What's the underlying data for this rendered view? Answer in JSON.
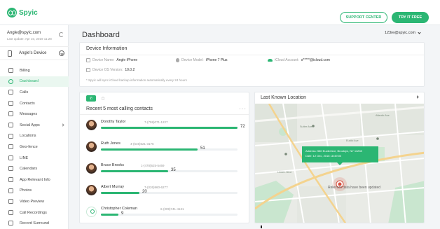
{
  "app": {
    "name": "Spyic"
  },
  "header": {
    "support_label": "SUPPORT CENTER",
    "try_label": "TRY IT FREE"
  },
  "account": {
    "email": "Angle@spyic.com",
    "last_update": "Last update: Apr 10, 2019 11:28"
  },
  "device": {
    "name": "Angle's Device"
  },
  "sidebar": {
    "items": [
      {
        "label": "Billing",
        "icon": "billing-icon",
        "active": false
      },
      {
        "label": "Dashboard",
        "icon": "dashboard-icon",
        "active": true
      },
      {
        "label": "Calls",
        "icon": "phone-icon",
        "active": false
      },
      {
        "label": "Contacts",
        "icon": "contacts-icon",
        "active": false
      },
      {
        "label": "Messages",
        "icon": "message-icon",
        "active": false
      },
      {
        "label": "Social Apps",
        "icon": "social-icon",
        "active": false,
        "has_submenu": true
      },
      {
        "label": "Locations",
        "icon": "location-icon",
        "active": false
      },
      {
        "label": "Geo-fence",
        "icon": "geofence-icon",
        "active": false
      },
      {
        "label": "LINE",
        "icon": "line-icon",
        "active": false
      },
      {
        "label": "Calendars",
        "icon": "calendar-icon",
        "active": false
      },
      {
        "label": "App Relevant Info",
        "icon": "app-info-icon",
        "active": false
      },
      {
        "label": "Photos",
        "icon": "photo-icon",
        "active": false
      },
      {
        "label": "Video Preview",
        "icon": "video-icon",
        "active": false
      },
      {
        "label": "Call Recordings",
        "icon": "mic-icon",
        "active": false
      },
      {
        "label": "Record Surround",
        "icon": "record-icon",
        "active": false
      }
    ]
  },
  "main": {
    "title": "Dashboard",
    "user": "123re@spyic.com"
  },
  "device_info": {
    "title": "Device Information",
    "name_label": "Device Name:",
    "name_value": "Angle iPhone",
    "model_label": "Device Model:",
    "model_value": "iPhone 7 Plus",
    "icloud_label": "iCloud Account:",
    "icloud_value": "s*****@icloud.com",
    "os_label": "Device OS Version:",
    "os_value": "10.0.2",
    "note": "* Spyic will sync iCloud backup information automatically every 24 hours"
  },
  "calls": {
    "title": "Recent 5 most calling contacts",
    "contacts": [
      {
        "name": "Dorothy Taylor",
        "phone": "7-(759)071-1227",
        "count": 72,
        "fill": 1.0
      },
      {
        "name": "Ruth Jones",
        "phone": "4-(646)521-3176",
        "count": 51,
        "fill": 0.71
      },
      {
        "name": "Bruce Brooks",
        "phone": "1-(478)625-5469",
        "count": 35,
        "fill": 0.49
      },
      {
        "name": "Albert Murray",
        "phone": "7-(026)960-6277",
        "count": 20,
        "fill": 0.28
      },
      {
        "name": "Christopher Coleman",
        "phone": "6-(009)741-4131",
        "count": 9,
        "fill": 0.13
      }
    ]
  },
  "location": {
    "title": "Last Known Location",
    "address": "Address: 580 Euclid Ave, Brooklyn, NY 11208",
    "date": "Date: 12 Dec, 2016  18:49:00",
    "note": "Relevant data have been updated",
    "street_labels": [
      "Sutter Ave",
      "Euclid Ave",
      "Linden Blvd",
      "Atlantic Ave"
    ]
  },
  "colors": {
    "brand": "#2bb673",
    "active_bg": "#eaf7f0"
  }
}
